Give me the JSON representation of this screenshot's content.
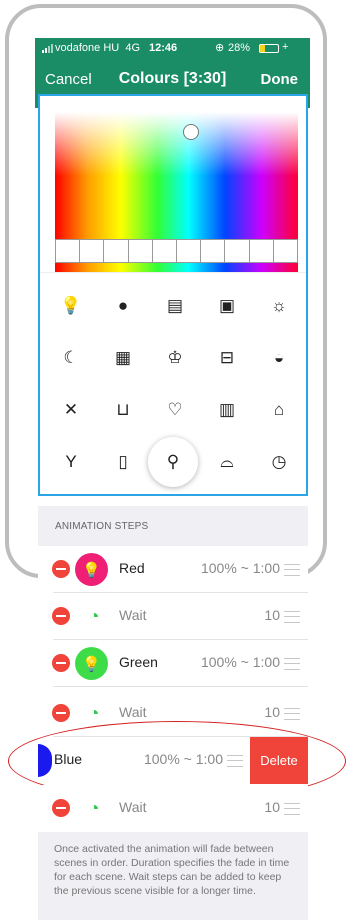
{
  "status_bar": {
    "carrier": "vodafone HU",
    "network": "4G",
    "time": "12:46",
    "battery_percent": "28%",
    "battery_level": 0.28
  },
  "nav": {
    "cancel_label": "Cancel",
    "title": "Colours [3:30]",
    "done_label": "Done"
  },
  "color_picker": {
    "swatch_count": 10
  },
  "icon_grid": {
    "icons": [
      "bulb-outline-icon",
      "bulb-filled-icon",
      "presentation-icon",
      "storage-icon",
      "sun-icon",
      "moon-icon",
      "film-icon",
      "chef-hat-icon",
      "bed-icon",
      "food-bowl-icon",
      "tools-icon",
      "armchair-icon",
      "heart-icon",
      "building-icon",
      "house-icon",
      "cocktail-icon",
      "books-icon",
      "balloons-icon",
      "sunrise-icon",
      "clock-icon"
    ],
    "selected_index": 17
  },
  "section_header": "ANIMATION STEPS",
  "steps": [
    {
      "label": "Red",
      "value": "100% ~ 1:00",
      "color": "#ee1f74"
    },
    {
      "label": "Wait",
      "value": "10"
    },
    {
      "label": "Green",
      "value": "100% ~ 1:00",
      "color": "#3fdc4a"
    },
    {
      "label": "Wait",
      "value": "10"
    },
    {
      "label": "Blue",
      "value": "100% ~ 1:00",
      "color": "#1a1aee"
    },
    {
      "label": "Wait",
      "value": "10"
    }
  ],
  "delete_label": "Delete",
  "footer_text": "Once activated the animation will fade between scenes in order. Duration specifies the fade in time for each scene. Wait steps can be added to keep the previous scene visible for a longer time."
}
